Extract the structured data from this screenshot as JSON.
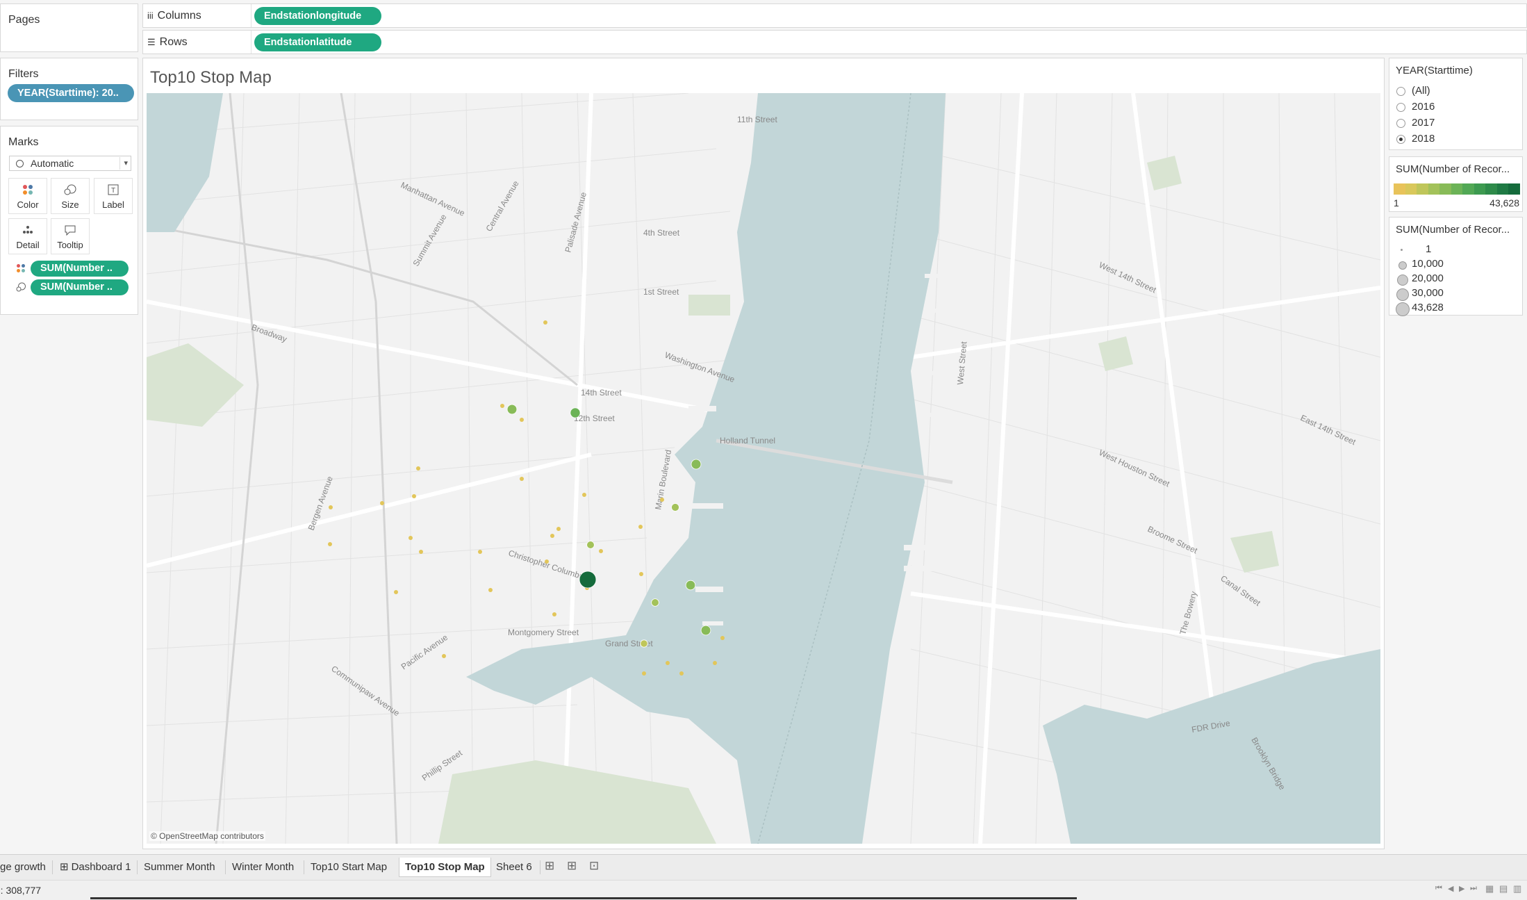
{
  "pages": {
    "title": "Pages"
  },
  "columns_shelf": {
    "label": "Columns",
    "pill": "Endstationlongitude"
  },
  "rows_shelf": {
    "label": "Rows",
    "pill": "Endstationlatitude"
  },
  "filters": {
    "title": "Filters",
    "pill": "YEAR(Starttime): 20.."
  },
  "marks": {
    "title": "Marks",
    "mark_type": "Automatic",
    "buttons": [
      {
        "label": "Color",
        "icon": "color-dots-icon"
      },
      {
        "label": "Size",
        "icon": "size-circles-icon"
      },
      {
        "label": "Label",
        "icon": "label-text-icon"
      },
      {
        "label": "Detail",
        "icon": "detail-dots-icon"
      },
      {
        "label": "Tooltip",
        "icon": "tooltip-bubble-icon"
      }
    ],
    "fields": [
      {
        "label": "SUM(Number ..",
        "icon": "color-dots-icon"
      },
      {
        "label": "SUM(Number ..",
        "icon": "size-circles-icon"
      }
    ]
  },
  "view": {
    "title": "Top10 Stop Map",
    "attribution": "© OpenStreetMap contributors",
    "map_labels": {
      "holland_tunnel": "Holland Tunnel",
      "street_14": "14th Street",
      "street_12": "12th Street",
      "grand_street": "Grand Street",
      "washington_ave": "Washington Avenue",
      "west_street": "West Street",
      "broadway": "Broadway",
      "christopher_columbus": "Christopher Columbus",
      "marin_blvd": "Marin Boulevard",
      "canal_street": "Canal Street",
      "fdr_drive": "FDR Drive",
      "st_11": "11th Street",
      "first_street": "1st Street",
      "fourth_street": "4th Street",
      "summit_ave": "Summit Avenue",
      "palisade_ave": "Palisade Avenue",
      "pacific_ave": "Pacific Avenue",
      "west_14": "West 14th Street",
      "east_14": "East 14th Street",
      "houston": "West Houston Street",
      "broome": "Broome Street",
      "bowery": "The Bowery",
      "manhattan_ave": "Manhattan Avenue",
      "central_ave": "Central Avenue",
      "bergen_ave": "Bergen Avenue",
      "montgomery": "Montgomery Street",
      "communipaw": "Communipaw Avenue",
      "phillip": "Phillip Street",
      "brooklyn_bridge": "Brooklyn Bridge"
    }
  },
  "year_filter": {
    "title": "YEAR(Starttime)",
    "options": [
      {
        "label": "(All)",
        "selected": false
      },
      {
        "label": "2016",
        "selected": false
      },
      {
        "label": "2017",
        "selected": false
      },
      {
        "label": "2018",
        "selected": true
      }
    ]
  },
  "color_legend": {
    "title": "SUM(Number of Recor...",
    "min": "1",
    "max": "43,628",
    "colors": [
      "#e8c35a",
      "#d9c85b",
      "#bfc65a",
      "#a3c25a",
      "#88bb58",
      "#6cb357",
      "#52a855",
      "#3d9a50",
      "#2e8b4a",
      "#1f7a44",
      "#156b3c"
    ]
  },
  "size_legend": {
    "title": "SUM(Number of Recor...",
    "items": [
      "1",
      "10,000",
      "20,000",
      "30,000",
      "43,628"
    ]
  },
  "tabs": [
    {
      "label": "ge growth",
      "active": false
    },
    {
      "label": "Dashboard 1",
      "active": false,
      "icon": "dashboard-grid-icon"
    },
    {
      "label": "Summer Month",
      "active": false
    },
    {
      "label": "Winter Month",
      "active": false
    },
    {
      "label": "Top10 Start Map",
      "active": false
    },
    {
      "label": "Top10 Stop Map",
      "active": true
    },
    {
      "label": "Sheet 6",
      "active": false
    }
  ],
  "status": {
    "text": "): 308,777"
  },
  "map_points": [
    {
      "v": 43628
    },
    {
      "v": 9000
    },
    {
      "v": 8500
    },
    {
      "v": 8200
    },
    {
      "v": 8000
    },
    {
      "v": 7800
    },
    {
      "v": 3500
    },
    {
      "v": 3200
    },
    {
      "v": 3000
    },
    {
      "v": 2500
    }
  ]
}
